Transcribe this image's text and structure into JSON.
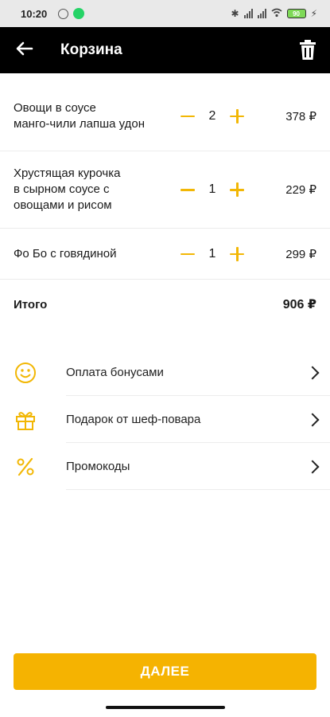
{
  "status_bar": {
    "time": "10:20",
    "battery": "90"
  },
  "app_bar": {
    "title": "Корзина"
  },
  "cart": {
    "items": [
      {
        "name": "Овощи  в соусе\nманго-чили лапша удон",
        "qty": "2",
        "price": "378 ₽"
      },
      {
        "name": "Хрустящая курочка\nв сырном соусе с\nовощами и рисом",
        "qty": "1",
        "price": "229 ₽"
      },
      {
        "name": "Фо Бо с говядиной",
        "qty": "1",
        "price": "299 ₽"
      }
    ],
    "total_label": "Итого",
    "total_value": "906 ₽"
  },
  "options": [
    {
      "label": "Оплата бонусами",
      "icon": "smile-icon"
    },
    {
      "label": "Подарок от шеф-повара",
      "icon": "gift-icon"
    },
    {
      "label": "Промокоды",
      "icon": "percent-icon"
    }
  ],
  "cta": {
    "label": "ДАЛЕЕ"
  },
  "colors": {
    "accent": "#f5b301",
    "appbar": "#000000",
    "statusbar": "#e9e9e9"
  }
}
